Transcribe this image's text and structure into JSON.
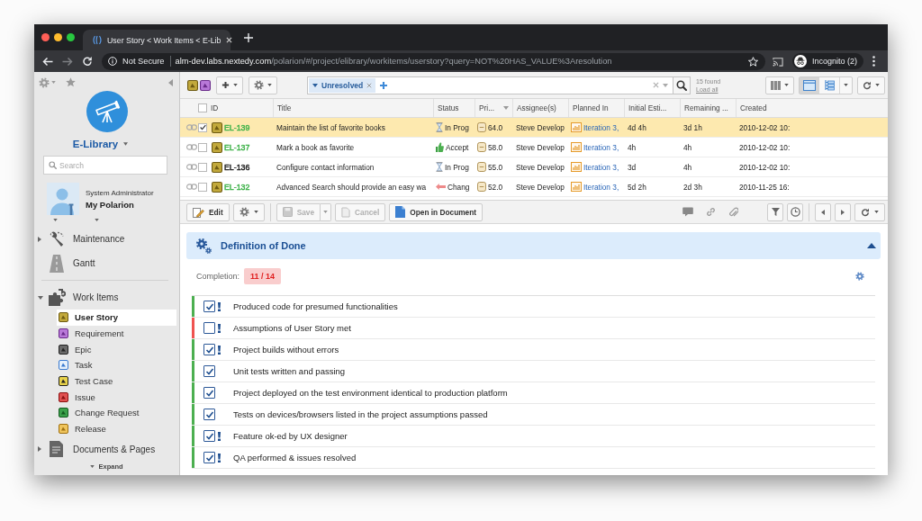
{
  "browser": {
    "tab": {
      "title": "User Story < Work Items < E-Lib"
    },
    "address": {
      "security": "Not Secure",
      "host": "alm-dev.labs.nextedy.com",
      "path": "/polarion/#/project/elibrary/workitems/userstory?query=NOT%20HAS_VALUE%3Aresolution"
    },
    "profile": "Incognito (2)"
  },
  "sidebar": {
    "project": "E-Library",
    "search": {
      "placeholder": "Search"
    },
    "user": {
      "role": "System Administrator",
      "name": "My Polarion"
    },
    "nav": [
      {
        "label": "Maintenance",
        "kind": "tools",
        "expanded": false
      },
      {
        "label": "Gantt",
        "kind": "gantt"
      },
      {
        "label": "Work Items",
        "kind": "workitems",
        "expanded": true,
        "children": [
          {
            "label": "User Story",
            "kind": "story",
            "selected": true
          },
          {
            "label": "Requirement",
            "kind": "requirement",
            "selected": false
          },
          {
            "label": "Epic",
            "kind": "epic",
            "selected": false
          },
          {
            "label": "Task",
            "kind": "task",
            "selected": false
          },
          {
            "label": "Test Case",
            "kind": "testcase",
            "selected": false
          },
          {
            "label": "Issue",
            "kind": "issue",
            "selected": false
          },
          {
            "label": "Change Request",
            "kind": "change",
            "selected": false
          },
          {
            "label": "Release",
            "kind": "release",
            "selected": false
          }
        ]
      },
      {
        "label": "Documents & Pages",
        "kind": "documents",
        "expanded": false
      }
    ],
    "expand": "Expand"
  },
  "toolbar": {
    "filter": {
      "chips": [
        "Unresolved"
      ]
    },
    "found": "15 found",
    "load_all": "Load all",
    "views": [
      {
        "kind": "document",
        "selected": true
      },
      {
        "kind": "tree",
        "selected": false
      }
    ]
  },
  "table": {
    "select_all": false,
    "columns": [
      "ID",
      "Title",
      "Status",
      "Pri...",
      "Assignee(s)",
      "Planned In",
      "Initial Esti...",
      "Remaining ...",
      "Created"
    ],
    "rows": [
      {
        "selected": true,
        "checked": true,
        "id": "EL-139",
        "color": "#3fb24a",
        "title": "Maintain the list of favorite books",
        "status": {
          "kind": "progress",
          "text": "In Prog"
        },
        "priority": "64.0",
        "assignee": "Steve Develop",
        "planned": "Iteration 3,",
        "initial": "4d 4h",
        "remaining": "3d 1h",
        "created": "2010-12-02 10:"
      },
      {
        "selected": false,
        "checked": false,
        "id": "EL-137",
        "color": "#3fb24a",
        "title": "Mark a book as favorite",
        "status": {
          "kind": "accepted",
          "text": "Accept"
        },
        "priority": "58.0",
        "assignee": "Steve Develop",
        "planned": "Iteration 3,",
        "initial": "4h",
        "remaining": "4h",
        "created": "2010-12-02 10:"
      },
      {
        "selected": false,
        "checked": false,
        "id": "EL-136",
        "color": "#222222",
        "title": "Configure contact information",
        "status": {
          "kind": "progress",
          "text": "In Prog"
        },
        "priority": "55.0",
        "assignee": "Steve Develop",
        "planned": "Iteration 3,",
        "initial": "3d",
        "remaining": "4h",
        "created": "2010-12-02 10:"
      },
      {
        "selected": false,
        "checked": false,
        "id": "EL-132",
        "color": "#3fb24a",
        "title": "Advanced Search should provide an easy wa",
        "status": {
          "kind": "changed",
          "text": "Chang"
        },
        "priority": "52.0",
        "assignee": "Steve Develop",
        "planned": "Iteration 3,",
        "initial": "5d 2h",
        "remaining": "2d 3h",
        "created": "2010-11-25 16:"
      }
    ]
  },
  "detail_toolbar": {
    "buttons": [
      {
        "label": "Edit",
        "kind": "edit",
        "disabled": false
      },
      {
        "label": "Save",
        "kind": "save",
        "disabled": true
      },
      {
        "label": "Cancel",
        "kind": "cancel",
        "disabled": true
      },
      {
        "label": "Open in Document",
        "kind": "open",
        "disabled": false
      }
    ]
  },
  "panel": {
    "title": "Definition of Done",
    "expanded": true,
    "completion_label": "Completion:",
    "completion": "11 / 14",
    "complete": false,
    "items": [
      {
        "text": "Produced code for presumed functionalities",
        "checked": true,
        "important": true
      },
      {
        "text": "Assumptions of User Story met",
        "checked": false,
        "important": true
      },
      {
        "text": "Project builds without errors",
        "checked": true,
        "important": true
      },
      {
        "text": "Unit tests written and passing",
        "checked": true,
        "important": false
      },
      {
        "text": "Project deployed on the test environment identical to production platform",
        "checked": true,
        "important": false
      },
      {
        "text": "Tests on devices/browsers listed in the project assumptions passed",
        "checked": true,
        "important": false
      },
      {
        "text": "Feature ok-ed by UX designer",
        "checked": true,
        "important": true
      },
      {
        "text": "QA performed & issues resolved",
        "checked": true,
        "important": true
      }
    ]
  }
}
